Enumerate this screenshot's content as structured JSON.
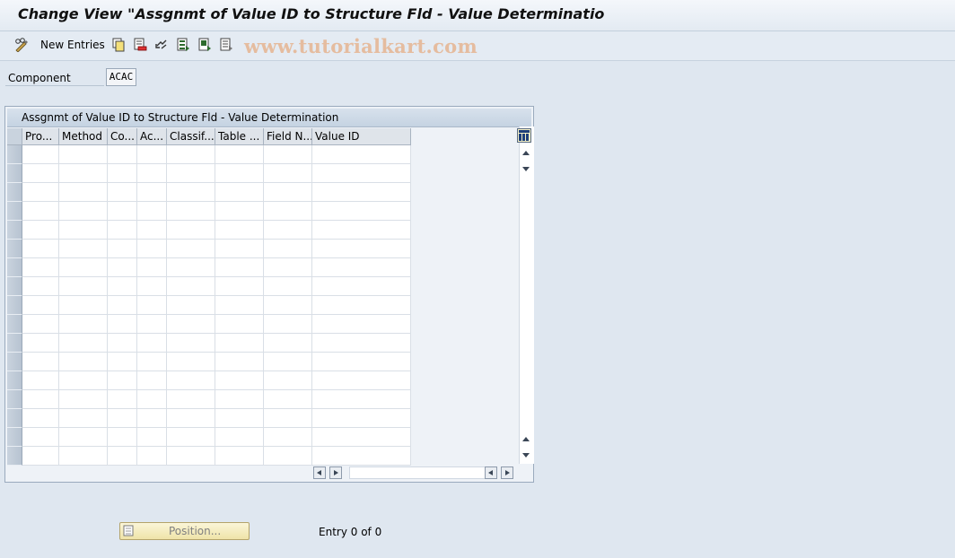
{
  "window": {
    "title": "Change View \"Assgnmt of Value ID to Structure Fld - Value Determinatio"
  },
  "toolbar": {
    "new_entries_label": "New Entries",
    "icons": [
      "edit-glasses-icon",
      "copy-icon",
      "delete-icon",
      "undo-icon",
      "select-all-icon",
      "select-block-icon",
      "deselect-all-icon"
    ]
  },
  "watermark": "www.tutorialkart.com",
  "header_fields": {
    "component_label": "Component",
    "component_value": "ACAC"
  },
  "table": {
    "title": "Assgnmt of Value ID to Structure Fld - Value Determination",
    "columns": [
      "Pro...",
      "Method",
      "Co...",
      "Ac...",
      "Classif....",
      "Table ...",
      "Field N...",
      "Value ID"
    ],
    "visible_rows": 17,
    "rows": []
  },
  "footer": {
    "position_button_label": "Position...",
    "entry_text": "Entry 0 of 0"
  },
  "colors": {
    "background": "#dfe7f0",
    "position_button": "#efe3a8",
    "watermark": "#e6965a"
  }
}
